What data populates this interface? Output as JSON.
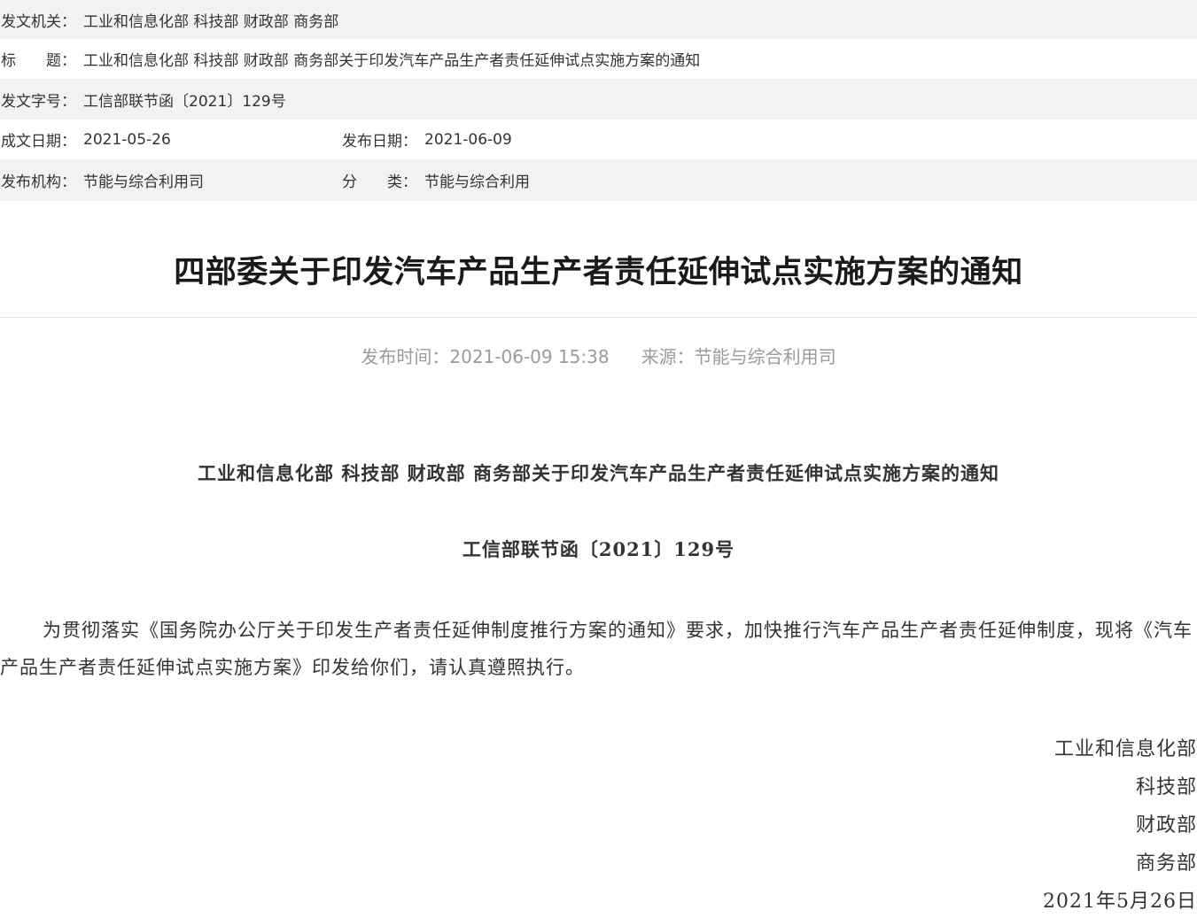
{
  "meta": {
    "issuer_label": "发文机关：",
    "issuer_value": "工业和信息化部 科技部 财政部 商务部",
    "title_label": "标　　题：",
    "title_value": "工业和信息化部 科技部 财政部 商务部关于印发汽车产品生产者责任延伸试点实施方案的通知",
    "docno_label": "发文字号：",
    "docno_value": "工信部联节函〔2021〕129号",
    "written_date_label": "成文日期：",
    "written_date_value": "2021-05-26",
    "publish_date_label": "发布日期：",
    "publish_date_value": "2021-06-09",
    "publisher_label": "发布机构：",
    "publisher_value": "节能与综合利用司",
    "category_label": "分　　类：",
    "category_value": "节能与综合利用"
  },
  "article": {
    "title": "四部委关于印发汽车产品生产者责任延伸试点实施方案的通知",
    "publish_time": "发布时间：2021-06-09 15:38",
    "source": "来源：节能与综合利用司"
  },
  "body": {
    "heading": "工业和信息化部 科技部 财政部 商务部关于印发汽车产品生产者责任延伸试点实施方案的通知",
    "doc_number": "工信部联节函〔2021〕129号",
    "paragraph": "为贯彻落实《国务院办公厅关于印发生产者责任延伸制度推行方案的通知》要求，加快推行汽车产品生产者责任延伸制度，现将《汽车产品生产者责任延伸试点实施方案》印发给你们，请认真遵照执行。",
    "signatures": [
      "工业和信息化部",
      "科技部",
      "财政部",
      "商务部",
      "2021年5月26日"
    ]
  }
}
